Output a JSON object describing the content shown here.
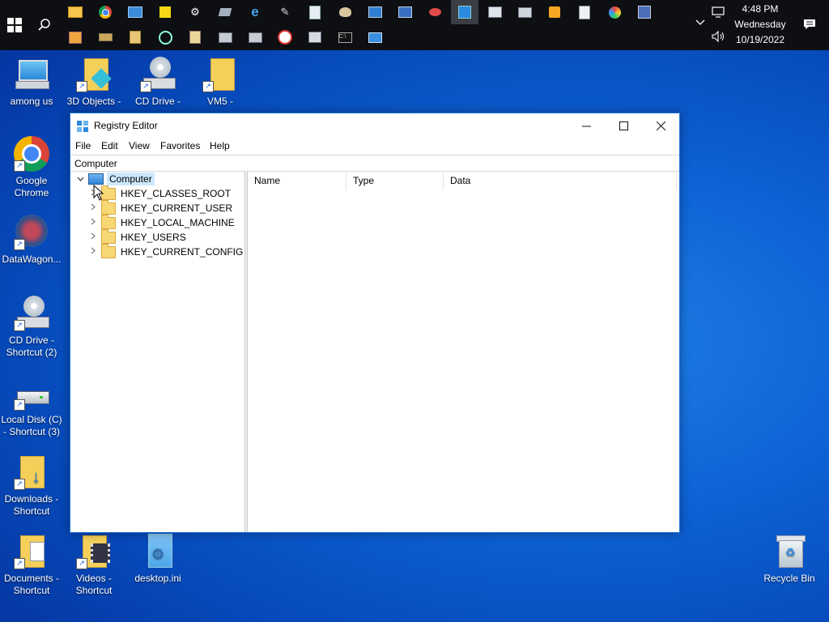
{
  "taskbar": {
    "clock_time": "4:48 PM",
    "clock_day": "Wednesday",
    "clock_date": "10/19/2022",
    "row1_icons": [
      "file-explorer-icon",
      "chrome-icon",
      "network-icon",
      "sticky-notes-icon",
      "settings-icon",
      "app-icon",
      "internet-explorer-icon",
      "signature-icon",
      "notepad-icon",
      "paint-icon",
      "remote-desktop-icon",
      "media-icon",
      "app2-icon",
      "registry-editor-icon",
      "window-icon",
      "printer-icon",
      "media-player-icon",
      "document-icon",
      "disc-icon",
      "app3-icon"
    ],
    "row2_icons": [
      "tool-icon",
      "drive-icon",
      "archive-icon",
      "search-folder-icon",
      "lock-file-icon",
      "storage-icon",
      "drive2-icon",
      "compass-icon",
      "printer2-icon",
      "command-prompt-icon",
      "monitor-icon"
    ]
  },
  "desktop": {
    "icons": [
      {
        "label": "among us"
      },
      {
        "label": "3D Objects -"
      },
      {
        "label": "CD Drive -"
      },
      {
        "label": "VM5 -"
      },
      {
        "label": "Google Chrome"
      },
      {
        "label": "DataWagon..."
      },
      {
        "label": "CD Drive - Shortcut (2)"
      },
      {
        "label": "Local Disk (C) - Shortcut (3)"
      },
      {
        "label": "Downloads - Shortcut"
      },
      {
        "label": "Documents - Shortcut"
      },
      {
        "label": "Videos - Shortcut"
      },
      {
        "label": "desktop.ini"
      },
      {
        "label": "Recycle Bin"
      }
    ]
  },
  "window": {
    "title": "Registry Editor",
    "menu": [
      "File",
      "Edit",
      "View",
      "Favorites",
      "Help"
    ],
    "address": "Computer",
    "tree": {
      "root": "Computer",
      "children": [
        "HKEY_CLASSES_ROOT",
        "HKEY_CURRENT_USER",
        "HKEY_LOCAL_MACHINE",
        "HKEY_USERS",
        "HKEY_CURRENT_CONFIG"
      ]
    },
    "columns": [
      "Name",
      "Type",
      "Data"
    ]
  }
}
